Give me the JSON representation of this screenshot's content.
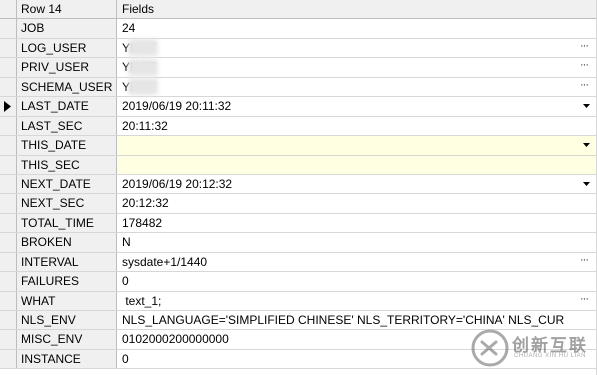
{
  "header": {
    "row_label": "Row 14",
    "fields_label": "Fields"
  },
  "rows": [
    {
      "name": "JOB",
      "value": "24"
    },
    {
      "name": "LOG_USER",
      "value": "YK      FT"
    },
    {
      "name": "PRIV_USER",
      "value": "YK      FT"
    },
    {
      "name": "SCHEMA_USER",
      "value": "YK      FT"
    },
    {
      "name": "LAST_DATE",
      "value": "2019/06/19 20:11:32"
    },
    {
      "name": "LAST_SEC",
      "value": "20:11:32"
    },
    {
      "name": "THIS_DATE",
      "value": ""
    },
    {
      "name": "THIS_SEC",
      "value": ""
    },
    {
      "name": "NEXT_DATE",
      "value": "2019/06/19 20:12:32"
    },
    {
      "name": "NEXT_SEC",
      "value": "20:12:32"
    },
    {
      "name": "TOTAL_TIME",
      "value": "178482"
    },
    {
      "name": "BROKEN",
      "value": "N"
    },
    {
      "name": "INTERVAL",
      "value": "sysdate+1/1440"
    },
    {
      "name": "FAILURES",
      "value": "0"
    },
    {
      "name": "WHAT",
      "value": " text_1;"
    },
    {
      "name": "NLS_ENV",
      "value": "NLS_LANGUAGE='SIMPLIFIED CHINESE' NLS_TERRITORY='CHINA' NLS_CUR"
    },
    {
      "name": "MISC_ENV",
      "value": "0102000200000000"
    },
    {
      "name": "INSTANCE",
      "value": "0"
    }
  ],
  "watermark": {
    "brand": "创新互联",
    "sub": "CHUANG XIN HU LIAN"
  }
}
